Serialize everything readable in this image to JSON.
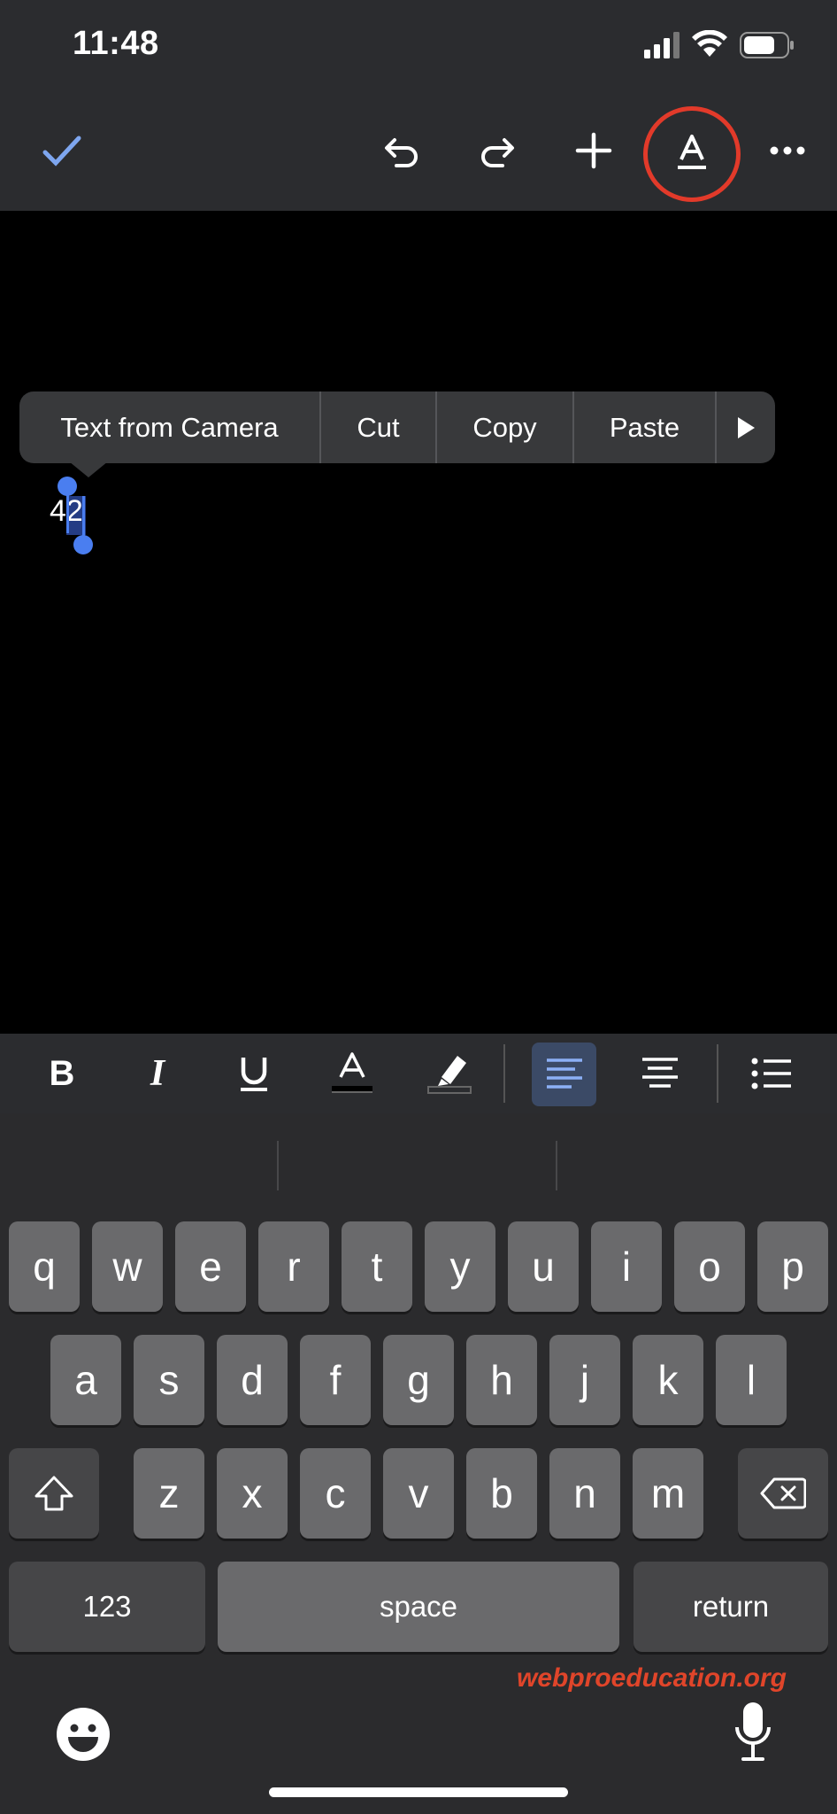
{
  "status_bar": {
    "time": "11:48"
  },
  "toolbar": {
    "icons": [
      "check-icon",
      "undo-icon",
      "redo-icon",
      "insert-plus-icon",
      "text-format-icon",
      "more-icon"
    ]
  },
  "context_menu": {
    "items": [
      "Text from Camera",
      "Cut",
      "Copy",
      "Paste"
    ],
    "more_icon": "play-triangle-icon"
  },
  "document": {
    "text": "42"
  },
  "format_bar": {
    "icons": [
      "bold-icon",
      "italic-icon",
      "underline-icon",
      "text-color-icon",
      "highlight-icon",
      "align-left-icon",
      "align-center-icon",
      "bulleted-list-icon"
    ],
    "active": "align-left-icon"
  },
  "keyboard": {
    "row1": [
      "q",
      "w",
      "e",
      "r",
      "t",
      "y",
      "u",
      "i",
      "o",
      "p"
    ],
    "row2": [
      "a",
      "s",
      "d",
      "f",
      "g",
      "h",
      "j",
      "k",
      "l"
    ],
    "row3": [
      "z",
      "x",
      "c",
      "v",
      "b",
      "n",
      "m"
    ],
    "numbers_label": "123",
    "space_label": "space",
    "return_label": "return"
  },
  "watermark": "webproeducation.org",
  "colors": {
    "accent": "#4a7ef0",
    "highlight_ring": "#e23a2a",
    "toolbar_bg": "#2b2c2f"
  }
}
